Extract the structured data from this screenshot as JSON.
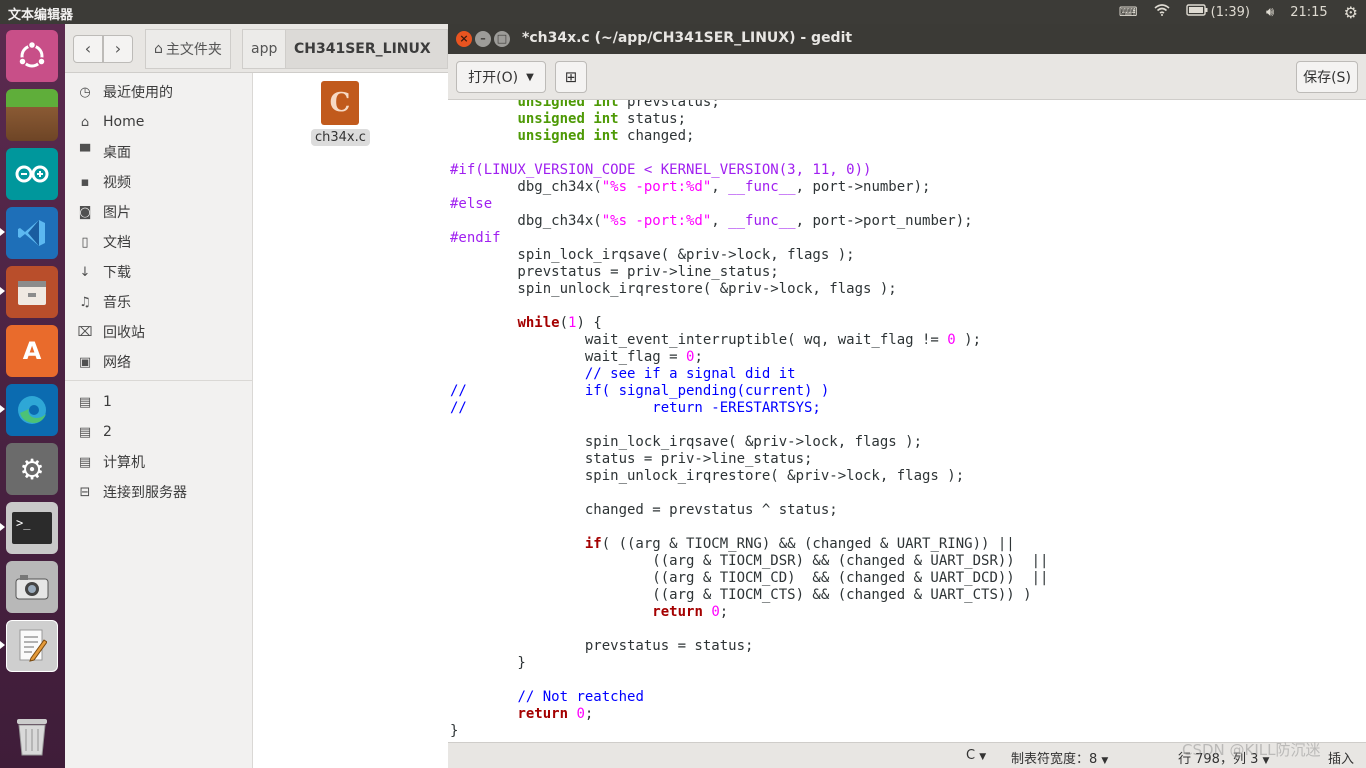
{
  "top_panel": {
    "app_name": "文本编辑器",
    "battery": "(1:39)",
    "clock": "21:15"
  },
  "launcher": {
    "items": [
      "ubuntu-dash",
      "minecraft",
      "arduino",
      "vscode",
      "files",
      "software-center",
      "edge",
      "system-settings",
      "terminal",
      "camera",
      "text-editor",
      "trash"
    ]
  },
  "files": {
    "breadcrumbs": [
      "主文件夹",
      "app",
      "CH341SER_LINUX"
    ],
    "sidebar": {
      "places": [
        "最近使用的",
        "Home",
        "桌面",
        "视频",
        "图片",
        "文档",
        "下载",
        "音乐",
        "回收站",
        "网络"
      ],
      "devices": [
        "1",
        "2",
        "计算机",
        "连接到服务器"
      ]
    },
    "file": {
      "name": "ch34x.c"
    }
  },
  "gedit": {
    "title": "*ch34x.c (~/app/CH341SER_LINUX) - gedit",
    "open_label": "打开(O)",
    "save_label": "保存(S)",
    "status": {
      "language": "C",
      "tab_width": "制表符宽度：8",
      "position": "行 798，列 3",
      "mode": "插入"
    },
    "code_lines": [
      "\tunsigned int prevstatus;",
      "\tunsigned int status;",
      "\tunsigned int changed;",
      "",
      "#if(LINUX_VERSION_CODE < KERNEL_VERSION(3, 11, 0))",
      "\tdbg_ch34x(\"%s -port:%d\", __func__, port->number);",
      "#else",
      "\tdbg_ch34x(\"%s -port:%d\", __func__, port->port_number);",
      "#endif",
      "\tspin_lock_irqsave( &priv->lock, flags );",
      "\tprevstatus = priv->line_status;",
      "\tspin_unlock_irqrestore( &priv->lock, flags );",
      "",
      "\twhile(1) {",
      "\t\twait_event_interruptible( wq, wait_flag != 0 );",
      "\t\twait_flag = 0;",
      "\t\t// see if a signal did it",
      "//\t\tif( signal_pending(current) )",
      "//\t\t\treturn -ERESTARTSYS;",
      "",
      "\t\tspin_lock_irqsave( &priv->lock, flags );",
      "\t\tstatus = priv->line_status;",
      "\t\tspin_unlock_irqrestore( &priv->lock, flags );",
      "",
      "\t\tchanged = prevstatus ^ status;",
      "",
      "\t\tif( ((arg & TIOCM_RNG) && (changed & UART_RING)) ||",
      "\t\t\t((arg & TIOCM_DSR) && (changed & UART_DSR))  ||",
      "\t\t\t((arg & TIOCM_CD)  && (changed & UART_DCD))  ||",
      "\t\t\t((arg & TIOCM_CTS) && (changed & UART_CTS)) )",
      "\t\t\treturn 0;",
      "",
      "\t\tprevstatus = status;",
      "\t}",
      "",
      "\t// Not reatched",
      "\treturn 0;",
      "}"
    ]
  },
  "watermark": "CSDN @KILL防沉迷"
}
